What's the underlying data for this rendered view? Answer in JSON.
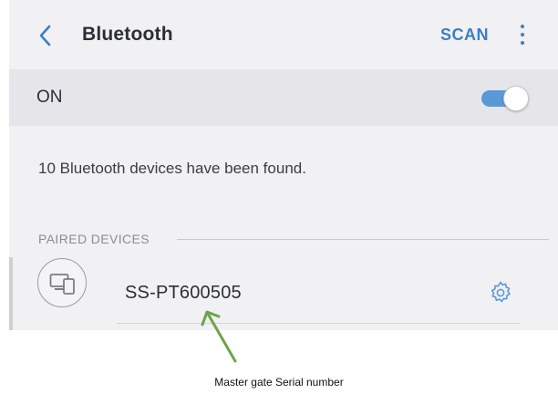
{
  "header": {
    "title": "Bluetooth",
    "scan_label": "SCAN",
    "back_icon": "chevron-left-icon",
    "more_icon": "more-vertical-icon",
    "accent_color": "#3d7ec4"
  },
  "toggle_row": {
    "label": "ON",
    "state": "on",
    "toggle_color": "#5b98d6"
  },
  "status": {
    "message": "10 Bluetooth devices have been found."
  },
  "paired": {
    "section_label": "PAIRED DEVICES",
    "devices": [
      {
        "name": "SS-PT600505",
        "icon": "devices-icon",
        "settings_icon": "gear-icon"
      }
    ]
  },
  "annotation": {
    "caption": "Master gate Serial number",
    "arrow_color": "#6fa34a"
  }
}
